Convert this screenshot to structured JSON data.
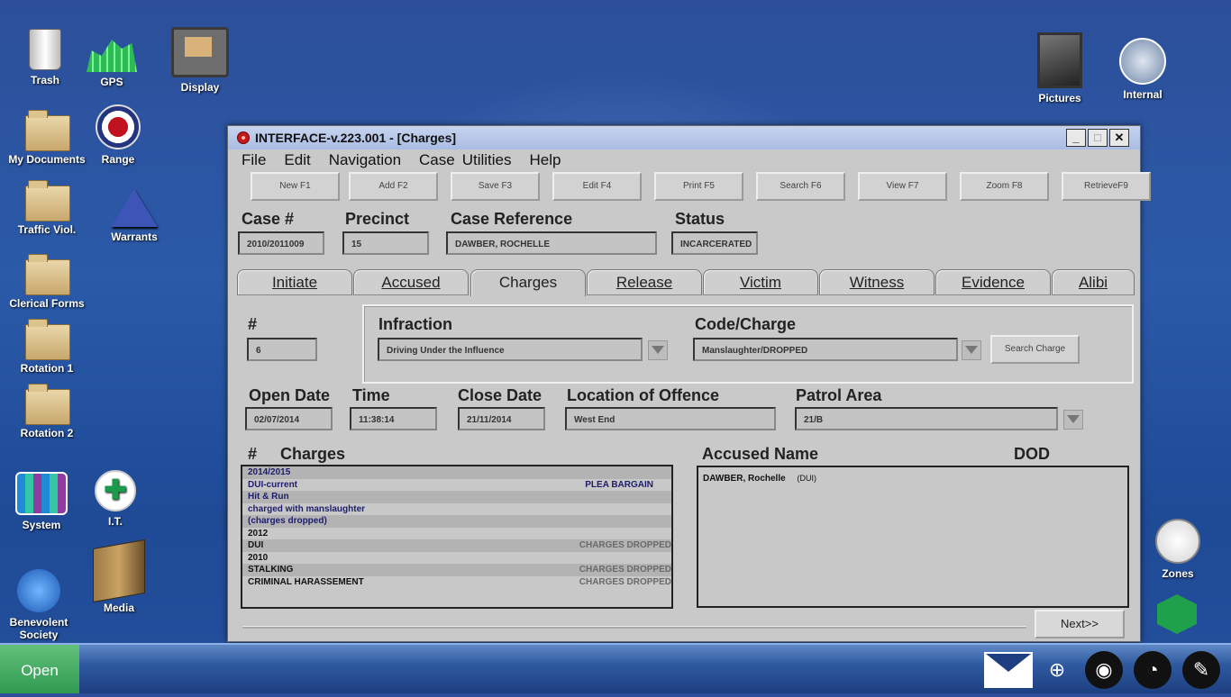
{
  "desktop": {
    "icons": {
      "trash": "Trash",
      "gps": "GPS",
      "display": "Display",
      "my_documents": "My Documents",
      "range": "Range",
      "traffic": "Traffic Viol.",
      "warrants": "Warrants",
      "clerical": "Clerical Forms",
      "rotation1": "Rotation 1",
      "rotation2": "Rotation 2",
      "system": "System",
      "it": "I.T.",
      "benevolent": "Benevolent Society",
      "media": "Media",
      "pictures": "Pictures",
      "internal": "Internal",
      "zones": "Zones"
    }
  },
  "window": {
    "title": "INTERFACE-v.223.001 - [Charges]",
    "menu": [
      "File",
      "Edit",
      "Navigation",
      "Case",
      "Utilities",
      "Help"
    ],
    "toolbar": [
      "New F1",
      "Add F2",
      "Save F3",
      "Edit F4",
      "Print F5",
      "Search F6",
      "View F7",
      "Zoom F8",
      "RetrieveF9"
    ],
    "header": {
      "case_label": "Case #",
      "case_value": "2010/2011009",
      "precinct_label": "Precinct",
      "precinct_value": "15",
      "ref_label": "Case Reference",
      "ref_value": "DAWBER, ROCHELLE",
      "status_label": "Status",
      "status_value": "INCARCERATED"
    },
    "tabs": [
      "Initiate",
      "Accused",
      "Charges",
      "Release",
      "Victim",
      "Witness",
      "Evidence",
      "Alibi"
    ],
    "active_tab": "Charges",
    "charge": {
      "num_label": "#",
      "num_value": "6",
      "infraction_label": "Infraction",
      "infraction_value": "Driving Under the Influence",
      "code_label": "Code/Charge",
      "code_value": "Manslaughter/DROPPED",
      "search_button": "Search Charge"
    },
    "dates": {
      "open_label": "Open Date",
      "open_value": "02/07/2014",
      "time_label": "Time",
      "time_value": "11:38:14",
      "close_label": "Close Date",
      "close_value": "21/11/2014",
      "location_label": "Location of Offence",
      "location_value": "West End",
      "patrol_label": "Patrol Area",
      "patrol_value": "21/B"
    },
    "charges_list": {
      "hash_label": "#",
      "title": "Charges",
      "rows": [
        {
          "text": "2014/2015",
          "right": "",
          "style": "navy"
        },
        {
          "text": "DUI-current",
          "right": "PLEA BARGAIN",
          "style": "navy"
        },
        {
          "text": "Hit & Run",
          "right": "",
          "style": "navy"
        },
        {
          "text": "charged with manslaughter",
          "right": "",
          "style": "navy"
        },
        {
          "text": "(charges dropped)",
          "right": "",
          "style": "navy"
        },
        {
          "text": "2012",
          "right": "",
          "style": "dark"
        },
        {
          "text": "DUI",
          "right": "CHARGES DROPPED",
          "style": "dark"
        },
        {
          "text": "2010",
          "right": "",
          "style": "dark"
        },
        {
          "text": "STALKING",
          "right": "CHARGES DROPPED",
          "style": "dark"
        },
        {
          "text": "CRIMINAL HARASSEMENT",
          "right": "CHARGES DROPPED",
          "style": "dark"
        }
      ]
    },
    "accused": {
      "name_label": "Accused Name",
      "dod_label": "DOD",
      "entry_name": "DAWBER, Rochelle",
      "entry_note": "(DUI)"
    },
    "next_button": "Next>>"
  },
  "taskbar": {
    "start_label": "Open"
  }
}
